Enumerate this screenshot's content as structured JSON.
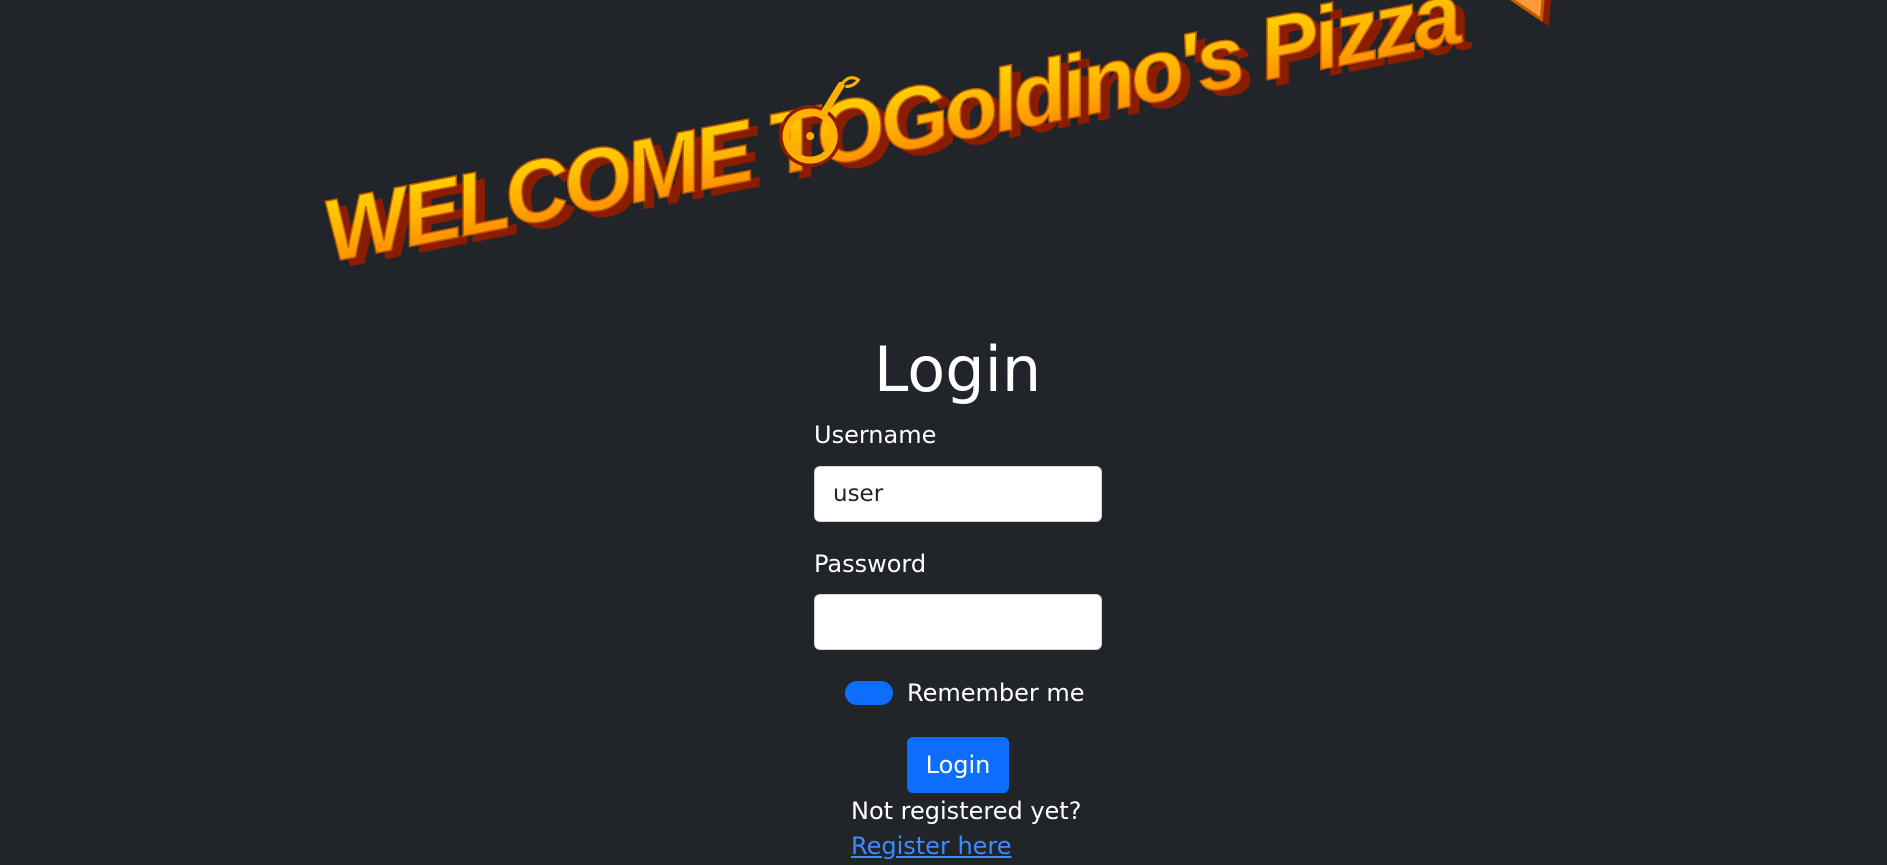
{
  "banner": {
    "part1": "WELCOME TO",
    "part2": "Goldino's Pizza"
  },
  "login": {
    "title": "Login",
    "username_label": "Username",
    "username_value": "user",
    "password_label": "Password",
    "password_value": "",
    "remember_label": "Remember me",
    "remember_checked": true,
    "submit_label": "Login",
    "register_prompt": "Not registered yet?",
    "register_link": "Register here"
  },
  "colors": {
    "background": "#212529",
    "accent": "#0d6efd",
    "link": "#3d8bfd",
    "banner_gold": "#ffc400",
    "banner_orange": "#ff8a00",
    "banner_shadow": "#8a1c00"
  },
  "icons": {
    "banner_logo": "pizza-cutter-icon",
    "banner_slice": "pizza-slice-icon"
  }
}
